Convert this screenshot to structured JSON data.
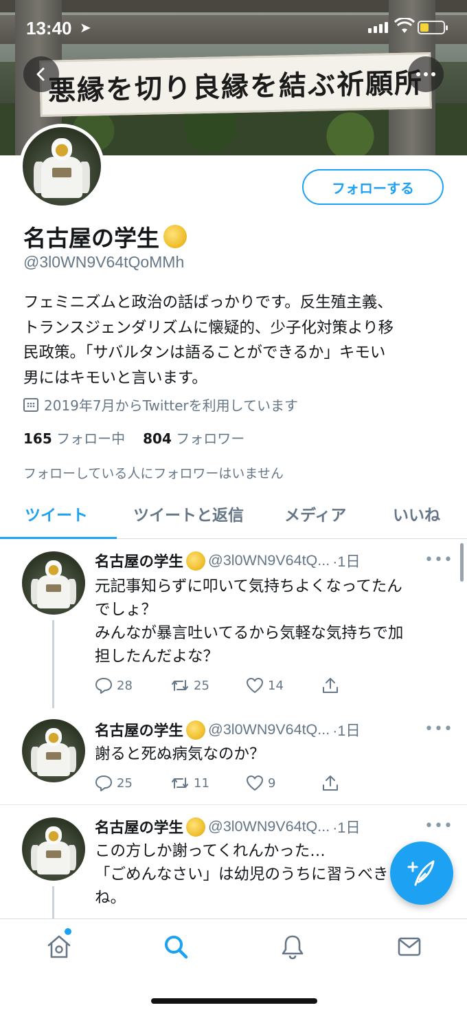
{
  "status_bar": {
    "time": "13:40",
    "location_glyph": "➤"
  },
  "banner": {
    "sign_text": "悪縁を切り良縁を結ぶ祈願所"
  },
  "profile": {
    "follow_label": "フォローする",
    "name": "名古屋の学生",
    "handle": "@3l0WN9V64tQoMMh",
    "bio": "フェミニズムと政治の話ばっかりです。反生殖主義、\nトランスジェンダリズムに懐疑的、少子化対策より移\n民政策。「サバルタンは語ることができるか」キモい\n男にはキモいと言います。",
    "joined": "2019年7月からTwitterを利用しています",
    "following_count": "165",
    "following_label": "フォロー中",
    "followers_count": "804",
    "followers_label": "フォロワー",
    "followed_by_note": "フォローしている人にフォロワーはいません"
  },
  "tabs": [
    {
      "label": "ツイート",
      "active": true
    },
    {
      "label": "ツイートと返信",
      "active": false
    },
    {
      "label": "メディア",
      "active": false
    },
    {
      "label": "いいね",
      "active": false
    }
  ],
  "tweets": [
    {
      "name": "名古屋の学生",
      "handle": "@3l0WN9V64tQ...",
      "time": "·1日",
      "text": "元記事知らずに叩いて気持ちよくなってたん\nでしょ？\nみんなが暴言吐いてるから気軽な気持ちで加\n担したんだよな？",
      "replies": "28",
      "retweets": "25",
      "likes": "14"
    },
    {
      "name": "名古屋の学生",
      "handle": "@3l0WN9V64tQ...",
      "time": "·1日",
      "text": "謝ると死ぬ病気なのか？",
      "replies": "25",
      "retweets": "11",
      "likes": "9"
    },
    {
      "name": "名古屋の学生",
      "handle": "@3l0WN9V64tQ...",
      "time": "·1日",
      "text": "この方しか謝ってくれんかった…\n「ごめんなさい」は幼児のうちに習うべき\nね。"
    }
  ],
  "more_glyph": "•••",
  "colors": {
    "accent": "#1da1f2",
    "secondary_text": "#657786",
    "divider": "#e1e8ed"
  },
  "icons": [
    "back-arrow-icon",
    "more-icon",
    "calendar-icon",
    "reply-icon",
    "retweet-icon",
    "like-icon",
    "share-icon",
    "compose-icon",
    "home-icon",
    "search-icon",
    "notifications-icon",
    "messages-icon"
  ]
}
